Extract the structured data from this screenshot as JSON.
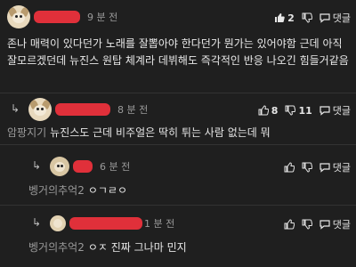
{
  "comments": [
    {
      "time": "9 분 전",
      "like_count": "2",
      "reply_label": "댓글",
      "text": "존나 매력이 있다던가 노래를 잘뽑아야 한다던가 뭔가는 있어야함 근데 아직 잘모르겠던데 뉴진스 원탑 체계라 데뷔해도 즉각적인 반응 나오긴 힘들거같음"
    },
    {
      "time": "8 분 전",
      "like_count": "8",
      "dislike_count": "11",
      "reply_label": "댓글",
      "mention": "암팡지기",
      "text": "뉴진스도 근데 비주얼은 딱히 튀는 사람 없는데 뭐"
    },
    {
      "time": "6 분 전",
      "reply_label": "댓글",
      "mention": "벵거의추억2",
      "text": "ㅇㄱㄹㅇ"
    },
    {
      "time": "1 분 전",
      "reply_label": "댓글",
      "mention": "벵거의추억2",
      "text": "ㅇㅈ 진짜 그나마 민지"
    }
  ],
  "icons": {
    "like": "thumbs-up-icon",
    "dislike": "thumbs-down-icon",
    "reply": "speech-bubble-icon",
    "reply_arrow": "reply-arrow-icon"
  },
  "colors": {
    "background": "#1f1f1f",
    "redaction": "#e0303a",
    "muted": "#9a9a9a"
  }
}
